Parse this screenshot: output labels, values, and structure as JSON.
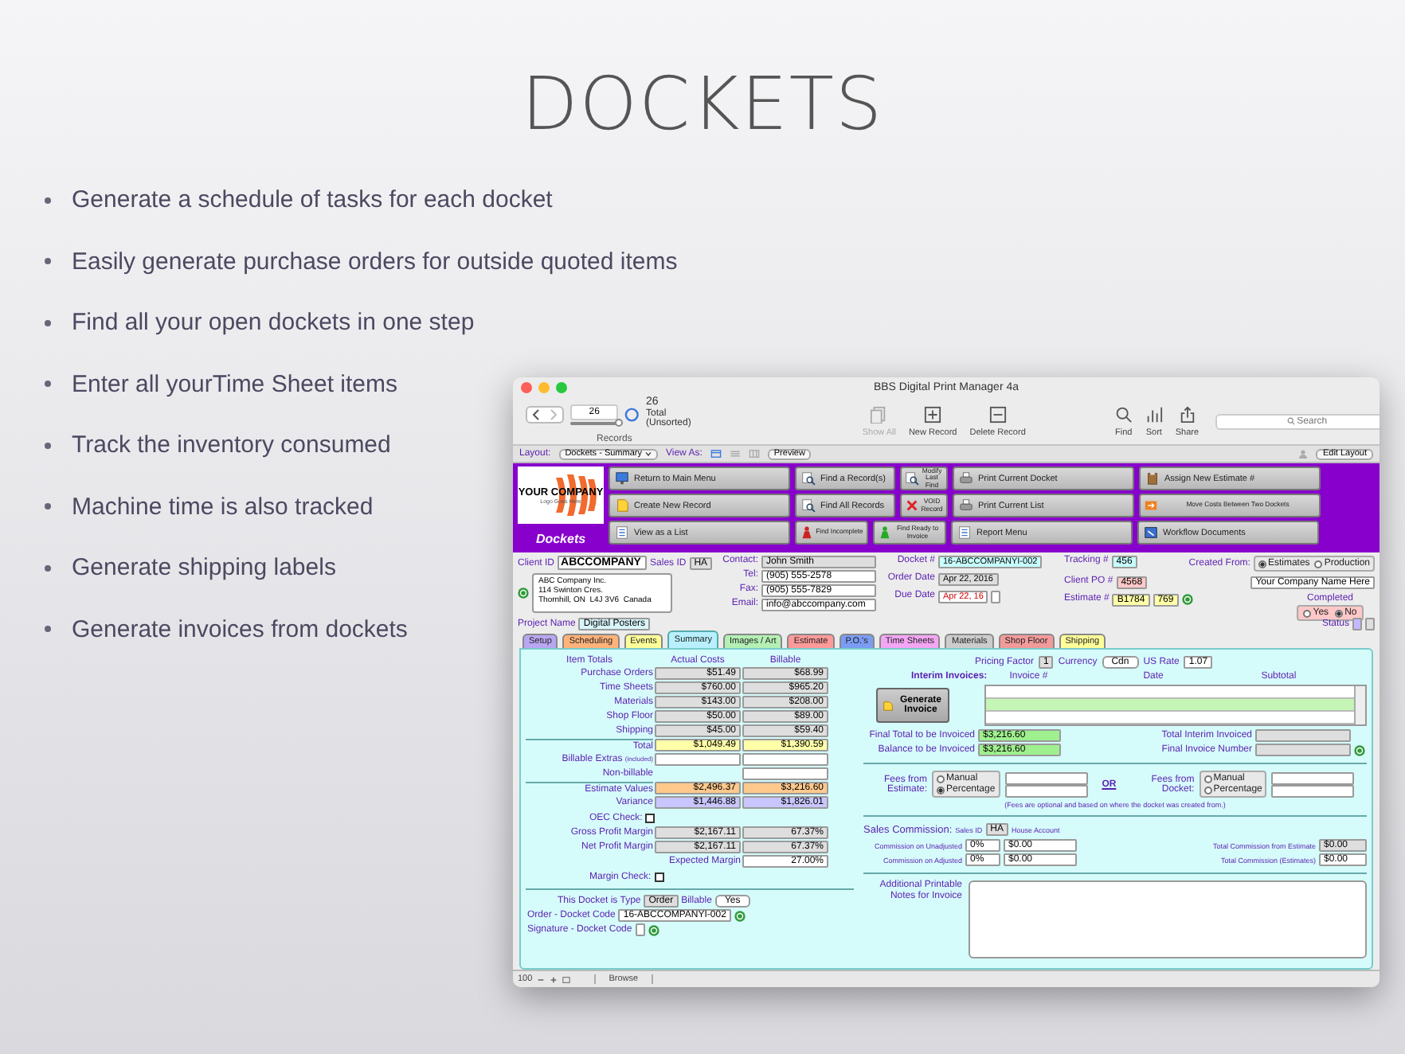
{
  "slide": {
    "title": "DOCKETS",
    "bullets": [
      "Generate a schedule of tasks for each docket",
      "Easily generate purchase orders for outside quoted items",
      "Find all your open dockets in one step",
      "Enter all yourTime Sheet items",
      "Track the inventory consumed",
      "Machine time is also tracked",
      "Generate shipping labels",
      "Generate invoices from dockets"
    ]
  },
  "window": {
    "title": "BBS  Digital Print Manager 4a"
  },
  "toolbar": {
    "record_number": "26",
    "record_slider": {
      "level": 1
    },
    "found_count": "26",
    "found_status": "Total (Unsorted)",
    "records_label": "Records",
    "buttons": [
      {
        "label": "Show All",
        "kind": "show-all",
        "disabled": true
      },
      {
        "label": "New Record",
        "kind": "new",
        "disabled": false
      },
      {
        "label": "Delete Record",
        "kind": "delete",
        "disabled": false
      },
      {
        "label": "Find",
        "kind": "find",
        "disabled": false
      },
      {
        "label": "Sort",
        "kind": "sort",
        "disabled": false
      },
      {
        "label": "Share",
        "kind": "share",
        "disabled": false
      }
    ],
    "search": {
      "placeholder": "Search"
    }
  },
  "layout_bar": {
    "layout_label": "Layout:",
    "layout": "Dockets - Summary",
    "view_as_label": "View As:",
    "view_modes": [
      {
        "kind": "form",
        "selected": true
      },
      {
        "kind": "list",
        "selected": false
      },
      {
        "kind": "table",
        "selected": false
      }
    ],
    "preview": "Preview",
    "edit_layout": "Edit Layout"
  },
  "header": {
    "logo_name": "YOUR COMPANY",
    "logo_tagline": "Logo Goes Here",
    "section": "Dockets",
    "button_rows": [
      [
        {
          "label": "Return to Main Menu",
          "kind": "wide"
        },
        {
          "label": "Find a Record(s)",
          "kind": "find"
        },
        {
          "label": "Modify Last Find",
          "kind": "mini"
        },
        {
          "label": "Print Current Docket",
          "kind": "wide"
        },
        {
          "label": "Assign New Estimate #",
          "kind": "wide"
        }
      ],
      [
        {
          "label": "Create New Record",
          "kind": "wide"
        },
        {
          "label": "Find All Records",
          "kind": "find"
        },
        {
          "label": "VOID Record",
          "kind": "mini"
        },
        {
          "label": "Print Current List",
          "kind": "wide"
        },
        {
          "label": "Move Costs Between Two Dockets",
          "kind": "wide-small"
        }
      ],
      [
        {
          "label": "View as a List",
          "kind": "wide"
        },
        {
          "label": "Find Incomplete",
          "kind": "half"
        },
        {
          "label": "Find Ready to Invoice",
          "kind": "half"
        },
        {
          "label": "Report Menu",
          "kind": "wide"
        },
        {
          "label": "Workflow Documents",
          "kind": "wide"
        }
      ]
    ]
  },
  "client": {
    "client_id_label": "Client ID",
    "client_id": "ABCCOMPANY",
    "sales_id_label": "Sales ID",
    "sales_id": "HA",
    "address": "ABC Company Inc.\n114 Swinton Cres.\nThornhill, ON  L4J 3V6  Canada",
    "contact": [
      {
        "label": "Contact:",
        "value": "John Smith",
        "kind": "gray"
      },
      {
        "label": "Tel:",
        "value": "(905) 555-2578",
        "kind": "white"
      },
      {
        "label": "Fax:",
        "value": "(905) 555-7829",
        "kind": "white"
      },
      {
        "label": "Email:",
        "value": "info@abccompany.com",
        "kind": "white"
      }
    ]
  },
  "docket": [
    {
      "label": "Docket #",
      "value": "16-ABCCOMPANYI-002",
      "kind": "cyan"
    },
    {
      "label": "Order Date",
      "value": "Apr 22, 2016",
      "kind": "gray"
    },
    {
      "label": "Due Date",
      "value": "Apr 22, 16",
      "kind": "overdue"
    }
  ],
  "tracking": [
    {
      "label": "Tracking #",
      "value": "456",
      "kind": "cyan"
    },
    {
      "label": "Client PO #",
      "value": "4568",
      "kind": "pink"
    },
    {
      "label": "Estimate #",
      "value": "B1784",
      "extra": "769",
      "kind": "yellow"
    }
  ],
  "created_from": {
    "label": "Created From:",
    "options": [
      {
        "label": "Estimates",
        "selected": true
      },
      {
        "label": "Production",
        "selected": false
      }
    ],
    "company": "Your Company Name Here"
  },
  "completed": {
    "label": "Completed",
    "options": [
      {
        "label": "Yes",
        "selected": false
      },
      {
        "label": "No",
        "selected": true
      }
    ]
  },
  "project": {
    "label": "Project Name",
    "value": "Digital Posters"
  },
  "status_label": "Status",
  "tabs": [
    {
      "label": "Setup",
      "color": "#b9a6f2",
      "selected": false
    },
    {
      "label": "Scheduling",
      "color": "#ffb27a",
      "selected": false
    },
    {
      "label": "Events",
      "color": "#ffff99",
      "selected": false
    },
    {
      "label": "Summary",
      "color": "#b8f0ff",
      "selected": true
    },
    {
      "label": "Images / Art",
      "color": "#b4f0b4",
      "selected": false
    },
    {
      "label": "Estimate",
      "color": "#ff9a9a",
      "selected": false
    },
    {
      "label": "P.O.'s",
      "color": "#7b9cf2",
      "selected": false
    },
    {
      "label": "Time Sheets",
      "color": "#f3a6f3",
      "selected": false
    },
    {
      "label": "Materials",
      "color": "#cccccc",
      "selected": false
    },
    {
      "label": "Shop Floor",
      "color": "#f29a9a",
      "selected": false
    },
    {
      "label": "Shipping",
      "color": "#ffff99",
      "selected": false
    }
  ],
  "costs": {
    "headers": [
      "Item Totals",
      "Actual Costs",
      "Billable"
    ],
    "rows": [
      {
        "label": "Purchase Orders",
        "actual": "$51.49",
        "billable": "$68.99",
        "kind": "line"
      },
      {
        "label": "Time Sheets",
        "actual": "$760.00",
        "billable": "$965.20",
        "kind": "line"
      },
      {
        "label": "Materials",
        "actual": "$143.00",
        "billable": "$208.00",
        "kind": "line"
      },
      {
        "label": "Shop Floor",
        "actual": "$50.00",
        "billable": "$89.00",
        "kind": "line"
      },
      {
        "label": "Shipping",
        "actual": "$45.00",
        "billable": "$59.40",
        "kind": "line"
      },
      {
        "label": "Total",
        "actual": "$1,049.49",
        "billable": "$1,390.59",
        "kind": "total"
      },
      {
        "label": "Billable Extras",
        "note": "(included)",
        "kind": "blank"
      },
      {
        "label": "Non-billable",
        "kind": "billable-only"
      },
      {
        "label": "Estimate Values",
        "actual": "$2,496.37",
        "billable": "$3,216.60",
        "kind": "estimate"
      },
      {
        "label": "Variance",
        "actual": "$1,446.88",
        "billable": "$1,826.01",
        "kind": "variance"
      }
    ]
  },
  "oec_check": {
    "label": "OEC Check:",
    "checked": false
  },
  "margins": [
    {
      "label": "Gross Profit Margin",
      "amount": "$2,167.11",
      "percent": "67.37%"
    },
    {
      "label": "Net Profit Margin",
      "amount": "$2,167.11",
      "percent": "67.37%"
    }
  ],
  "expected_margin": {
    "label": "Expected Margin",
    "value": "27.00%"
  },
  "margin_check": {
    "label": "Margin Check:",
    "checked": false
  },
  "docket_type": {
    "label": "This Docket is Type",
    "value": "Order",
    "billable_label": "Billable",
    "billable": "Yes"
  },
  "codes": [
    {
      "label": "Order - Docket Code",
      "value": "16-ABCCOMPANYI-002"
    },
    {
      "label": "Signature - Docket Code"
    }
  ],
  "pricing": {
    "pricing_factor_label": "Pricing Factor",
    "pricing_factor": "1",
    "currency_label": "Currency",
    "currency": "Cdn",
    "us_rate_label": "US Rate",
    "us_rate": "1.07"
  },
  "interim": {
    "label": "Interim Invoices:",
    "columns": [
      "Invoice #",
      "Date",
      "Subtotal"
    ],
    "generate": "Generate Invoice"
  },
  "invoicing": [
    {
      "label": "Final Total to be Invoiced",
      "value": "$3,216.60"
    },
    {
      "label": "Balance to be Invoiced",
      "value": "$3,216.60"
    }
  ],
  "invoice_right": [
    {
      "label": "Total Interim Invoiced"
    },
    {
      "label": "Final Invoice Number"
    }
  ],
  "fees": {
    "groups": [
      {
        "label": "Fees from Estimate:",
        "options": [
          {
            "label": "Manual",
            "selected": false
          },
          {
            "label": "Percentage",
            "selected": true
          }
        ]
      },
      {
        "label": "Fees from Docket:",
        "options": [
          {
            "label": "Manual",
            "selected": false
          },
          {
            "label": "Percentage",
            "selected": false
          }
        ]
      }
    ],
    "or": "OR",
    "note": "(Fees are optional and based on where the docket was created from.)"
  },
  "commission": {
    "label": "Sales Commission:",
    "sales_id_label": "Sales ID",
    "sales_id": "HA",
    "house": "House Account",
    "rows": [
      {
        "label": "Commission on Unadjusted",
        "percent": "0%",
        "amount": "$0.00"
      },
      {
        "label": "Commission on Adjusted",
        "percent": "0%",
        "amount": "$0.00"
      }
    ],
    "totals": [
      {
        "label": "Total Commission from Estimate",
        "value": "$0.00"
      },
      {
        "label": "Total Commission (Estimates)",
        "value": "$0.00"
      }
    ]
  },
  "notes": {
    "label": "Additional Printable Notes for Invoice"
  },
  "status_bar": {
    "zoom": "100",
    "mode": "Browse"
  }
}
